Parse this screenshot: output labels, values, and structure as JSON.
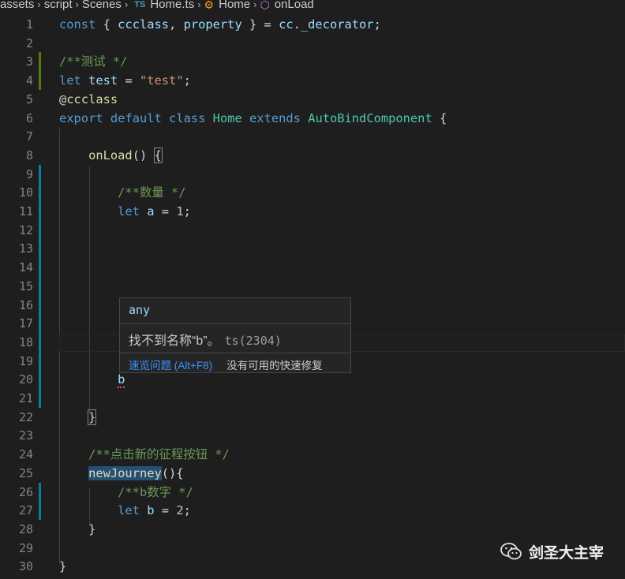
{
  "breadcrumb": {
    "items": [
      {
        "label": "assets"
      },
      {
        "label": "script"
      },
      {
        "label": "Scenes"
      },
      {
        "label": "Home.ts",
        "badge": "TS"
      },
      {
        "label": "Home",
        "icon": "class-icon"
      },
      {
        "label": "onLoad",
        "icon": "method-icon"
      }
    ]
  },
  "colors": {
    "keyword": "#569cd6",
    "variable": "#9cdcfe",
    "class": "#4ec9b0",
    "function": "#dcdcaa",
    "string": "#ce9178",
    "number": "#b5cea8",
    "comment": "#6a9955",
    "gutter_modified": "#0c7d9d",
    "gutter_added": "#587c0c",
    "link": "#3794ff"
  },
  "lines": [
    {
      "n": "1",
      "t": [
        [
          "kw",
          "const"
        ],
        [
          "pun",
          " { "
        ],
        [
          "var",
          "ccclass"
        ],
        [
          "pun",
          ", "
        ],
        [
          "var",
          "property"
        ],
        [
          "pun",
          " } = "
        ],
        [
          "var",
          "cc"
        ],
        [
          "pun",
          "."
        ],
        [
          "var",
          "_decorator"
        ],
        [
          "pun",
          ";"
        ]
      ]
    },
    {
      "n": "2",
      "t": []
    },
    {
      "n": "3",
      "t": [
        [
          "com",
          "/**测试 */"
        ]
      ],
      "gutter": "added"
    },
    {
      "n": "4",
      "t": [
        [
          "kw",
          "let"
        ],
        [
          "pun",
          " "
        ],
        [
          "var",
          "test"
        ],
        [
          "pun",
          " = "
        ],
        [
          "str",
          "\"test\""
        ],
        [
          "pun",
          ";"
        ]
      ],
      "gutter": "added"
    },
    {
      "n": "5",
      "t": [
        [
          "pun",
          "@"
        ],
        [
          "dec",
          "ccclass"
        ]
      ]
    },
    {
      "n": "6",
      "t": [
        [
          "kw",
          "export"
        ],
        [
          "pun",
          " "
        ],
        [
          "kw",
          "default"
        ],
        [
          "pun",
          " "
        ],
        [
          "kw",
          "class"
        ],
        [
          "pun",
          " "
        ],
        [
          "cls",
          "Home"
        ],
        [
          "pun",
          " "
        ],
        [
          "kw",
          "extends"
        ],
        [
          "pun",
          " "
        ],
        [
          "cls",
          "AutoBindComponent"
        ],
        [
          "pun",
          " {"
        ]
      ]
    },
    {
      "n": "7",
      "t": []
    },
    {
      "n": "8",
      "t": [
        [
          "pun",
          "    "
        ],
        [
          "fn",
          "onLoad"
        ],
        [
          "pun",
          "() "
        ],
        [
          "pun brace-box",
          "{"
        ]
      ]
    },
    {
      "n": "9",
      "t": [],
      "gutter": "modified"
    },
    {
      "n": "10",
      "t": [
        [
          "pun",
          "        "
        ],
        [
          "com",
          "/**数量 */"
        ]
      ],
      "gutter": "modified"
    },
    {
      "n": "11",
      "t": [
        [
          "pun",
          "        "
        ],
        [
          "kw",
          "let"
        ],
        [
          "pun",
          " "
        ],
        [
          "var",
          "a"
        ],
        [
          "pun",
          " = "
        ],
        [
          "num",
          "1"
        ],
        [
          "pun",
          ";"
        ]
      ],
      "gutter": "modified"
    },
    {
      "n": "12",
      "t": [],
      "gutter": "modified"
    },
    {
      "n": "13",
      "t": [],
      "gutter": "modified"
    },
    {
      "n": "14",
      "t": [],
      "gutter": "modified"
    },
    {
      "n": "15",
      "t": [],
      "gutter": "modified"
    },
    {
      "n": "16",
      "t": [],
      "gutter": "modified"
    },
    {
      "n": "17",
      "t": [],
      "gutter": "modified"
    },
    {
      "n": "18",
      "t": [],
      "gutter": "modified"
    },
    {
      "n": "19",
      "t": [],
      "gutter": "modified"
    },
    {
      "n": "20",
      "t": [
        [
          "pun",
          "        "
        ],
        [
          "var squiggle",
          "b"
        ]
      ],
      "gutter": "modified"
    },
    {
      "n": "21",
      "t": [],
      "gutter": "modified"
    },
    {
      "n": "22",
      "t": [
        [
          "pun",
          "    "
        ],
        [
          "pun brace-box",
          "}"
        ]
      ]
    },
    {
      "n": "23",
      "t": []
    },
    {
      "n": "24",
      "t": [
        [
          "pun",
          "    "
        ],
        [
          "com",
          "/**点击新的征程按钮 */"
        ]
      ]
    },
    {
      "n": "25",
      "t": [
        [
          "pun",
          "    "
        ],
        [
          "fn hl-word",
          "newJourney"
        ],
        [
          "pun",
          "(){"
        ]
      ]
    },
    {
      "n": "26",
      "t": [
        [
          "pun",
          "        "
        ],
        [
          "com",
          "/**b数字 */"
        ]
      ],
      "gutter": "modified"
    },
    {
      "n": "27",
      "t": [
        [
          "pun",
          "        "
        ],
        [
          "kw",
          "let"
        ],
        [
          "pun",
          " "
        ],
        [
          "var",
          "b"
        ],
        [
          "pun",
          " = "
        ],
        [
          "num",
          "2"
        ],
        [
          "pun",
          ";"
        ]
      ],
      "gutter": "modified"
    },
    {
      "n": "28",
      "t": [
        [
          "pun",
          "    }"
        ]
      ]
    },
    {
      "n": "29",
      "t": []
    },
    {
      "n": "30",
      "t": [
        [
          "pun",
          "}"
        ]
      ]
    }
  ],
  "hover": {
    "type": "any",
    "message": "找不到名称“b”。",
    "code": "ts(2304)",
    "peek_label": "速览问题 (Alt+F8)",
    "no_fix_label": "没有可用的快速修复"
  },
  "watermark": {
    "text": "剑圣大主宰",
    "icon": "wechat-icon"
  }
}
